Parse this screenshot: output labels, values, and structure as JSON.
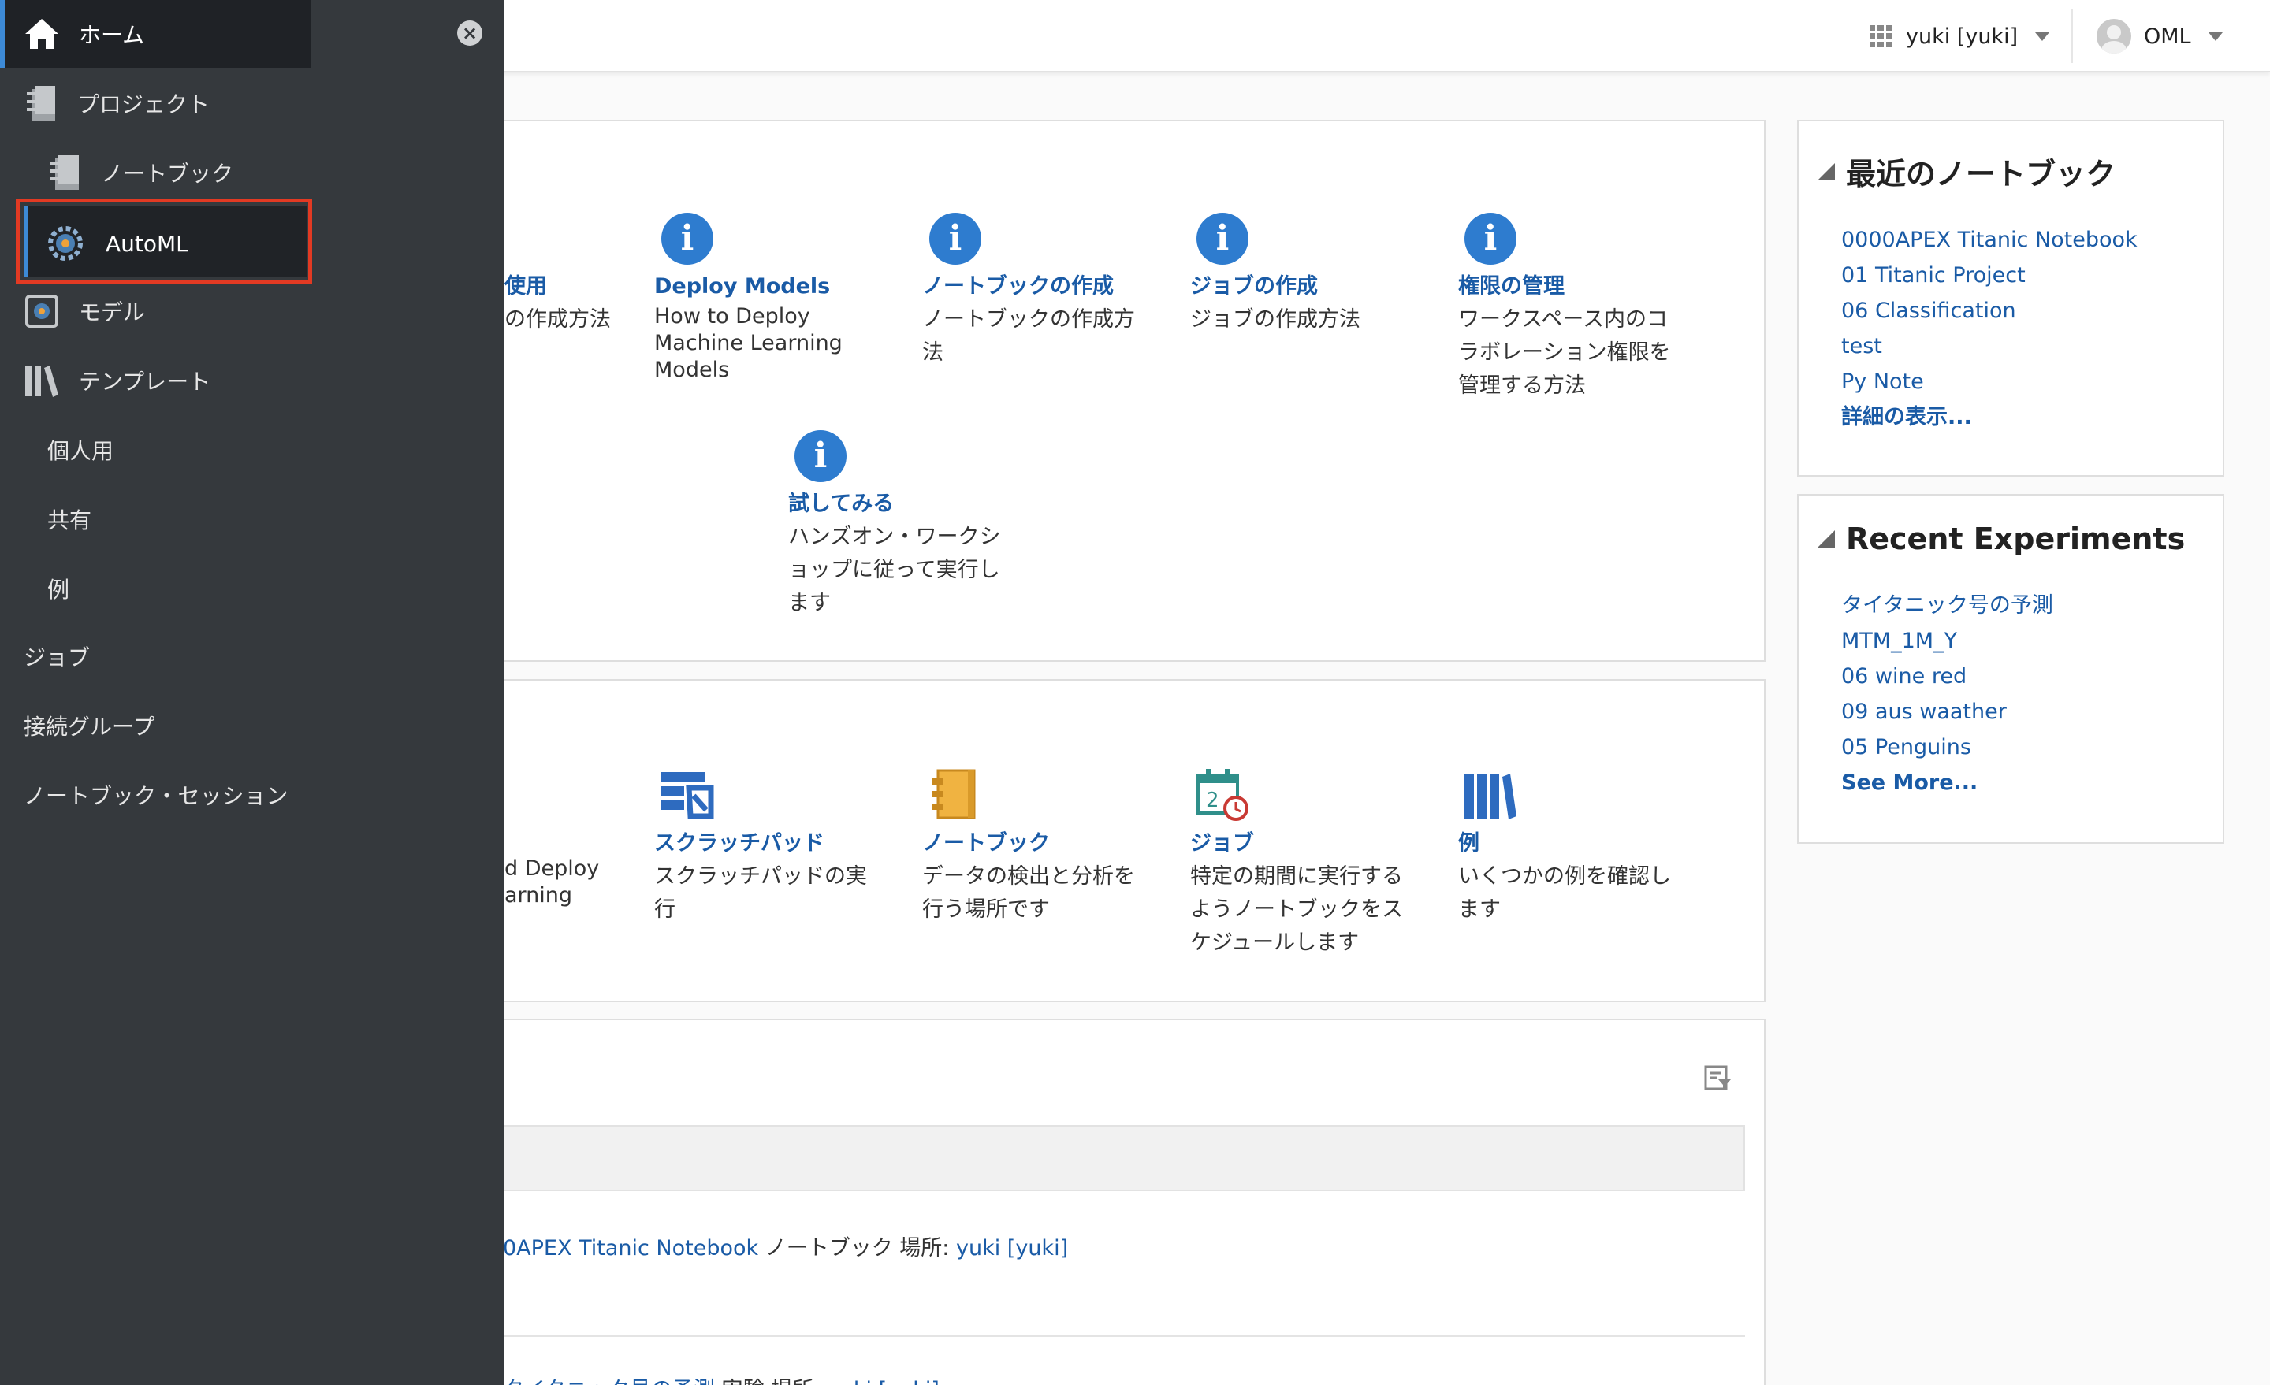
{
  "header": {
    "workspace": "yuki [yuki]",
    "user": "OML"
  },
  "sidebar": {
    "home": "ホーム",
    "projects": "プロジェクト",
    "notebooks": "ノートブック",
    "automl": "AutoML",
    "models": "モデル",
    "templates": "テンプレート",
    "personal": "個人用",
    "shared": "共有",
    "examples": "例",
    "jobs": "ジョブ",
    "connection_groups": "接続グループ",
    "notebook_sessions": "ノートブック・セッション"
  },
  "howto": {
    "partial_title": "使用",
    "partial_desc": "の作成方法",
    "tiles": [
      {
        "title": "Deploy Models",
        "lines": [
          "How to Deploy",
          "Machine Learning",
          "Models"
        ]
      },
      {
        "title": "ノートブックの作成",
        "lines": [
          "ノートブックの作成方",
          "法"
        ]
      },
      {
        "title": "ジョブの作成",
        "lines": [
          "ジョブの作成方法"
        ]
      },
      {
        "title": "権限の管理",
        "lines": [
          "ワークスペース内のコ",
          "ラボレーション権限を",
          "管理する方法"
        ]
      },
      {
        "title": "試してみる",
        "lines": [
          "ハンズオン・ワークシ",
          "ョップに従って実行し",
          "ます"
        ]
      }
    ]
  },
  "quickactions": {
    "partial_lines": [
      "d Deploy",
      "arning"
    ],
    "tiles": [
      {
        "title": "スクラッチパッド",
        "lines": [
          "スクラッチパッドの実",
          "行"
        ]
      },
      {
        "title": "ノートブック",
        "lines": [
          "データの検出と分析を",
          "行う場所です"
        ]
      },
      {
        "title": "ジョブ",
        "lines": [
          "特定の期間に実行する",
          "ようノートブックをス",
          "ケジュールします"
        ]
      },
      {
        "title": "例",
        "lines": [
          "いくつかの例を確認し",
          "ます"
        ]
      }
    ]
  },
  "recent_activities": {
    "row1": {
      "link": "0APEX Titanic Notebook",
      "type": " ノートブック 場所: ",
      "location": "yuki [yuki]"
    },
    "row2": {
      "link": "タイタニック号の予測",
      "type": " 実験 場所: ",
      "location": "yuki [yuki]"
    }
  },
  "recent_notebooks": {
    "title": "最近のノートブック",
    "items": [
      "0000APEX Titanic Notebook",
      "01 Titanic Project",
      "06 Classification",
      "test",
      "Py Note"
    ],
    "more": "詳細の表示..."
  },
  "recent_experiments": {
    "title": "Recent Experiments",
    "items": [
      "タイタニック号の予測",
      "MTM_1M_Y",
      "06 wine red",
      "09 aus waather",
      "05 Penguins"
    ],
    "more": "See More..."
  },
  "colors": {
    "link": "#1a5ba6",
    "sidebar": "#35393d",
    "highlight": "#e23a23",
    "accent": "#3d8ad6"
  }
}
